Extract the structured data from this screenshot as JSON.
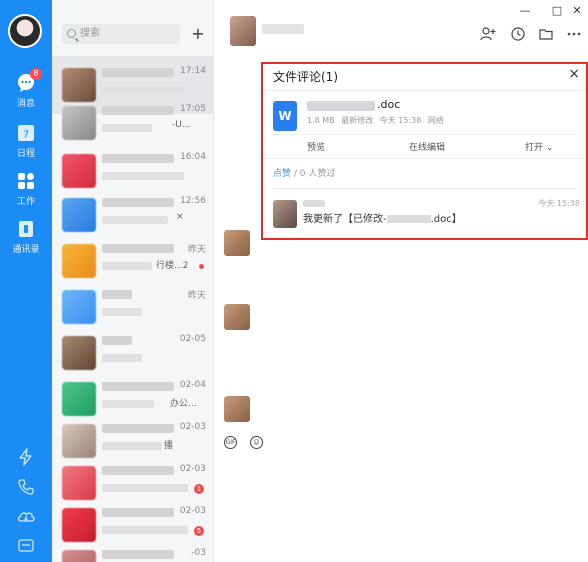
{
  "rail": {
    "items": [
      {
        "label": "消息",
        "badge": "8"
      },
      {
        "label": "日程",
        "day": "7"
      },
      {
        "label": "工作"
      },
      {
        "label": "通讯录"
      }
    ]
  },
  "list": {
    "search_placeholder": "搜索",
    "add_label": "+",
    "conversations": [
      {
        "time": "17:14"
      },
      {
        "time": "17:05",
        "preview_text": "-U..."
      },
      {
        "time": "16:04"
      },
      {
        "time": "12:56",
        "preview_text": "×"
      },
      {
        "time": "昨天",
        "preview_text": "行楼...2"
      },
      {
        "time": "昨天"
      },
      {
        "time": "02-05"
      },
      {
        "time": "02-04",
        "preview_text": "办公..."
      },
      {
        "time": "02-03",
        "preview_text": "播"
      },
      {
        "time": "02-03",
        "unread": "1"
      },
      {
        "time": "02-03",
        "unread": "5"
      },
      {
        "time": "-03"
      }
    ]
  },
  "window": {
    "min": "—",
    "max": "□",
    "close": "✕"
  },
  "panel": {
    "title": "文件评论(1)",
    "close": "×",
    "doc_ext": ".doc",
    "doc_icon_letter": "W",
    "doc_size": "1.8 MB",
    "doc_meta_mid": "最新修改",
    "doc_time": "今天 15:38",
    "doc_meta_end": "网络",
    "action_preview": "预览",
    "action_edit": "在线编辑",
    "action_open": "打开 ⌄",
    "like_action": "点赞",
    "like_count": "/ 0 人赞过",
    "comment_time": "今天 15:38",
    "comment_prefix": "我更新了【已修改-",
    "comment_suffix": ".doc】"
  }
}
